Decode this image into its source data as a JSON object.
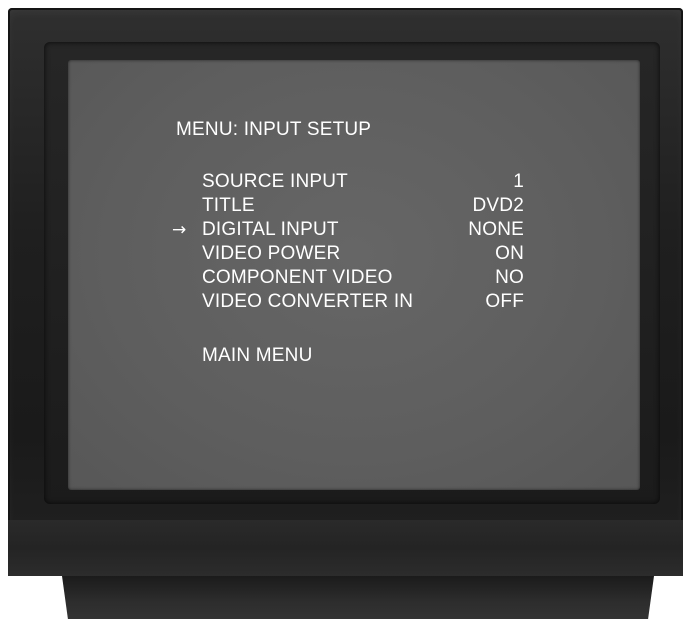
{
  "menu": {
    "title": "MENU: INPUT SETUP",
    "selected_index": 2,
    "pointer_icon": "right-arrow-icon",
    "pointer_glyph": "→",
    "items": [
      {
        "label": "SOURCE INPUT",
        "value": "1"
      },
      {
        "label": "TITLE",
        "value": "DVD2"
      },
      {
        "label": "DIGITAL INPUT",
        "value": "NONE"
      },
      {
        "label": "VIDEO POWER",
        "value": "ON"
      },
      {
        "label": "COMPONENT VIDEO",
        "value": "NO"
      },
      {
        "label": "VIDEO CONVERTER IN",
        "value": "OFF"
      }
    ],
    "main_menu_label": "MAIN MENU"
  },
  "colors": {
    "screen": "#5f5f5f",
    "text": "#ffffff",
    "cabinet": "#222222"
  }
}
